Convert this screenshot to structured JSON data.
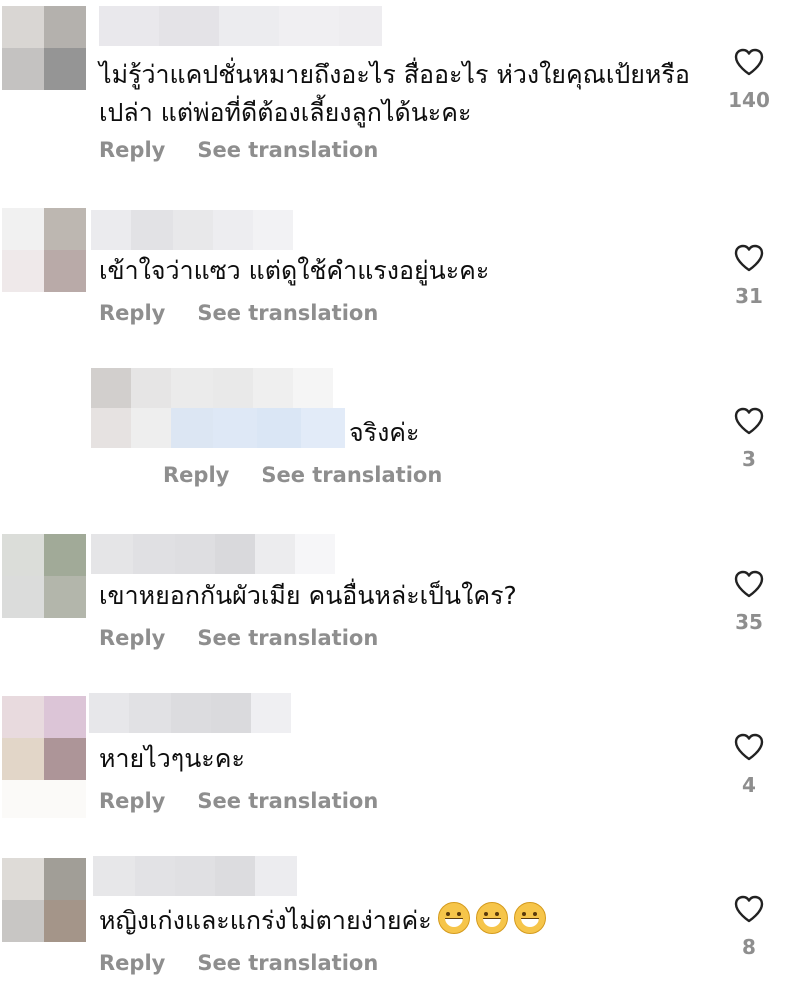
{
  "actions": {
    "reply_label": "Reply",
    "translate_label": "See translation"
  },
  "comments": [
    {
      "text_lines": [
        "ไม่รู้ว่าแคปชั่นหมายถึงอะไร สื่ออะไร ห่วงใยคุณเป้ยหรือ",
        "เปล่า แต่พ่อที่ดีต้องเลี้ยงลูกได้นะคะ"
      ],
      "likes": "140"
    },
    {
      "text_lines": [
        "เข้าใจว่าแซว แต่ดูใช้คำแรงอยู่นะคะ"
      ],
      "likes": "31"
    },
    {
      "text_lines": [
        "จริงค่ะ"
      ],
      "likes": "3",
      "is_reply": true
    },
    {
      "text_lines": [
        "เขาหยอกกันผัวเมีย คนอื่นหล่ะเป็นใคร?"
      ],
      "likes": "35"
    },
    {
      "text_lines": [
        "หายไวๆนะคะ"
      ],
      "likes": "4"
    },
    {
      "text_lines": [
        "หญิงเก่งและแกร่งไม่ตายง่ายค่ะ"
      ],
      "likes": "8",
      "emoji": [
        "grinning-face",
        "grinning-face",
        "grinning-face"
      ]
    }
  ],
  "colors": {
    "action_gray": "#8e8e8e",
    "text": "#0d0d0d",
    "heart_outline": "#222222"
  }
}
